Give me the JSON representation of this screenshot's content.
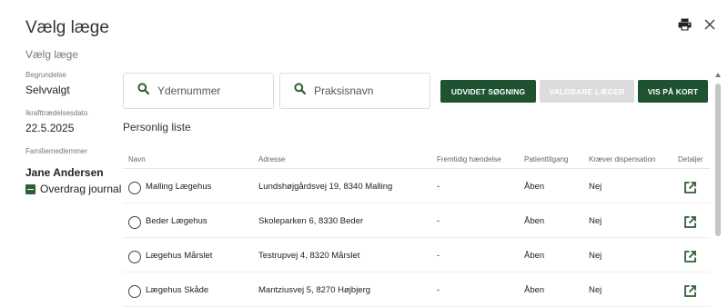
{
  "header": {
    "title": "Vælg læge",
    "subtitle": "Vælg læge"
  },
  "sidebar": {
    "fields": [
      {
        "label": "Begrundelse",
        "value": "Selvvalgt"
      },
      {
        "label": "Ikrafttrædelsesdato",
        "value": "22.5.2025"
      }
    ],
    "members_label": "Familiemedlemmer",
    "member": {
      "name": "Jane Andersen",
      "action_label": "Overdrag journal",
      "checked": true
    }
  },
  "search": {
    "field1_placeholder": "Ydernummer",
    "field2_placeholder": "Praksisnavn"
  },
  "buttons": {
    "extended_search": "UDVIDET SØGNING",
    "selectable_doctors": "VALGBARE LÆGER",
    "show_on_map": "VIS PÅ KORT"
  },
  "list": {
    "title": "Personlig liste",
    "columns": {
      "name": "Navn",
      "address": "Adresse",
      "future_event": "Fremtidig hændelse",
      "patient_access": "Patienttilgang",
      "requires_dispensation": "Kræver dispensation",
      "details": "Detaljer"
    },
    "rows": [
      {
        "name": "Malling Lægehus",
        "address": "Lundshøjgårdsvej 19, 8340 Malling",
        "event": "-",
        "access": "Åben",
        "dispensation": "Nej"
      },
      {
        "name": "Beder Lægehus",
        "address": "Skoleparken 6, 8330 Beder",
        "event": "-",
        "access": "Åben",
        "dispensation": "Nej"
      },
      {
        "name": "Lægehus Mårslet",
        "address": "Testrupvej 4, 8320 Mårslet",
        "event": "-",
        "access": "Åben",
        "dispensation": "Nej"
      },
      {
        "name": "Lægehus Skåde",
        "address": "Mantziusvej 5, 8270 Højbjerg",
        "event": "-",
        "access": "Åben",
        "dispensation": "Nej"
      }
    ]
  },
  "icons": {
    "print": "print-icon",
    "close": "close-icon",
    "search": "search-icon",
    "details": "open-in-new-icon"
  },
  "colors": {
    "primary": "#1e5230",
    "disabled": "#dcdcdc",
    "icon_green": "#2e5e34"
  }
}
